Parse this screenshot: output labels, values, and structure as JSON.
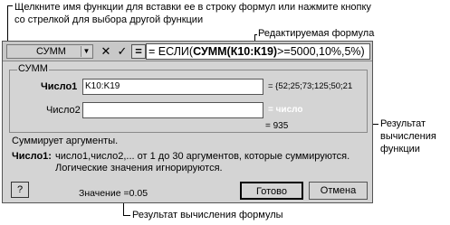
{
  "callouts": {
    "top_left": [
      "Щелкните имя функции для вставки ее в строку формул или нажмите кнопку",
      "со стрелкой для выбора другой функции"
    ],
    "edited_formula": "Редактируемая формула",
    "calc_result_fn": [
      "Результат",
      "вычисления",
      "функции"
    ],
    "calc_result_formula": "Результат вычисления формулы"
  },
  "formula_bar": {
    "function_name": "СУММ",
    "cancel_symbol": "✕",
    "enter_symbol": "✓",
    "equals_symbol": "=",
    "formula_prefix": "= ЕСЛИ(",
    "formula_bold": "СУММ(К10:К19)",
    "formula_suffix": ">=5000,10%,5%)"
  },
  "group": {
    "title": "СУММ",
    "arg1_label": "Число1",
    "arg1_value": "K10:K19",
    "arg1_result": "= {52;25;73;125;50;21",
    "arg2_label": "Число2",
    "arg2_value": "",
    "arg2_result": "= число"
  },
  "function_result": "= 935",
  "description": "Суммирует аргументы.",
  "arg_help": {
    "label": "Число1:",
    "line1": "число1,число2,... от 1 до 30 аргументов, которые суммируются.",
    "line2": "Логические значения игнорируются."
  },
  "value_text": "Значение =0.05",
  "buttons": {
    "help": "?",
    "ok": "Готово",
    "cancel": "Отмена"
  }
}
